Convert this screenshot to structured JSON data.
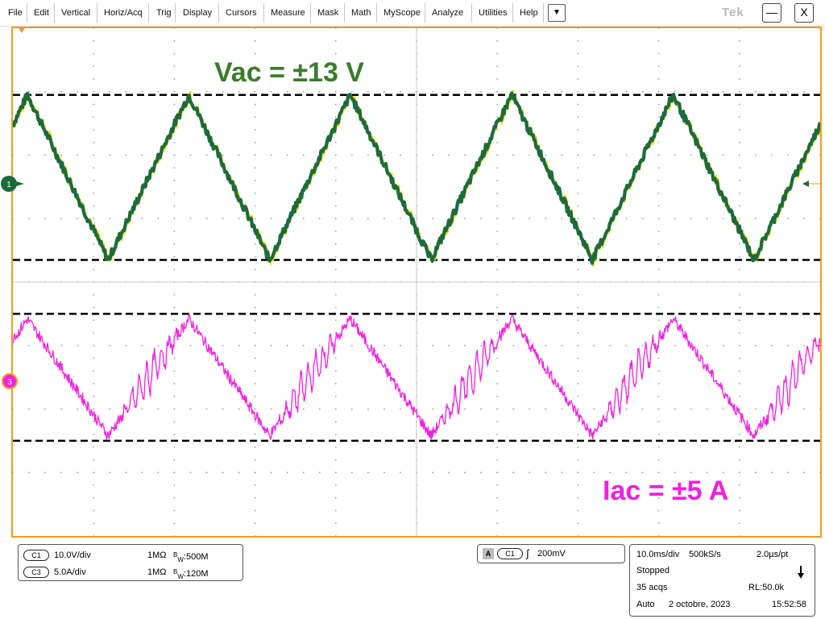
{
  "menu": {
    "items": [
      "File",
      "Edit",
      "Vertical",
      "Horiz/Acq",
      "Trig",
      "Display",
      "Cursors",
      "Measure",
      "Mask",
      "Math",
      "MyScope",
      "Analyze",
      "Utilities",
      "Help"
    ],
    "more_icon": "chevron-down-icon",
    "more_glyph": "▼",
    "brand": "Tek",
    "minimize_glyph": "—",
    "close_glyph": "X"
  },
  "annotations": {
    "vac": "Vac = ±13 V",
    "iac": "Iac = ±5 A"
  },
  "markers": {
    "ch1_marker": "1",
    "ch3_marker": "3"
  },
  "channels": {
    "c1": {
      "name": "C1",
      "scale": "10.0V/div",
      "impedance": "1MΩ",
      "bw_prefix": "B",
      "bw_sub": "W",
      "bandwidth": ":500M"
    },
    "c3": {
      "name": "C3",
      "scale": "5.0A/div",
      "impedance": "1MΩ",
      "bw_prefix": "B",
      "bw_sub": "W",
      "bandwidth": ":120M"
    }
  },
  "trigger": {
    "mode_badge": "A",
    "source": "C1",
    "slope_glyph": "∫",
    "level": "200mV"
  },
  "acquisition": {
    "timebase": "10.0ms/div",
    "sample_rate": "500kS/s",
    "sample_interval": "2.0µs/pt",
    "state": "Stopped",
    "acqs": "35 acqs",
    "record_length": "RL:50.0k",
    "mode": "Auto",
    "date": "2 octobre, 2023",
    "time": "15:52:58"
  },
  "colors": {
    "frame": "#f29c1f",
    "ch1": "#1d6b3a",
    "ch1_highlight": "#e8e000",
    "ch3": "#f020e0",
    "vac_label": "#3b7b2c",
    "iac_label": "#f020e0"
  },
  "chart_data": {
    "type": "line",
    "x_divisions": 10,
    "y_divisions": 8,
    "x_unit": "ms",
    "xlim": [
      0,
      100
    ],
    "series": [
      {
        "name": "Vac",
        "channel": "C1",
        "unit": "V",
        "shape": "triangle",
        "frequency_hz": 50,
        "amplitude": 13,
        "offset_div": 1.65
      },
      {
        "name": "Iac",
        "channel": "C3",
        "unit": "A",
        "shape": "distorted-triangle",
        "frequency_hz": 50,
        "amplitude": 5,
        "offset_div": -1.5
      }
    ],
    "reference_lines": [
      {
        "series": "Vac",
        "value": 13
      },
      {
        "series": "Vac",
        "value": -13
      },
      {
        "series": "Iac",
        "value": 5
      },
      {
        "series": "Iac",
        "value": -5
      }
    ]
  }
}
